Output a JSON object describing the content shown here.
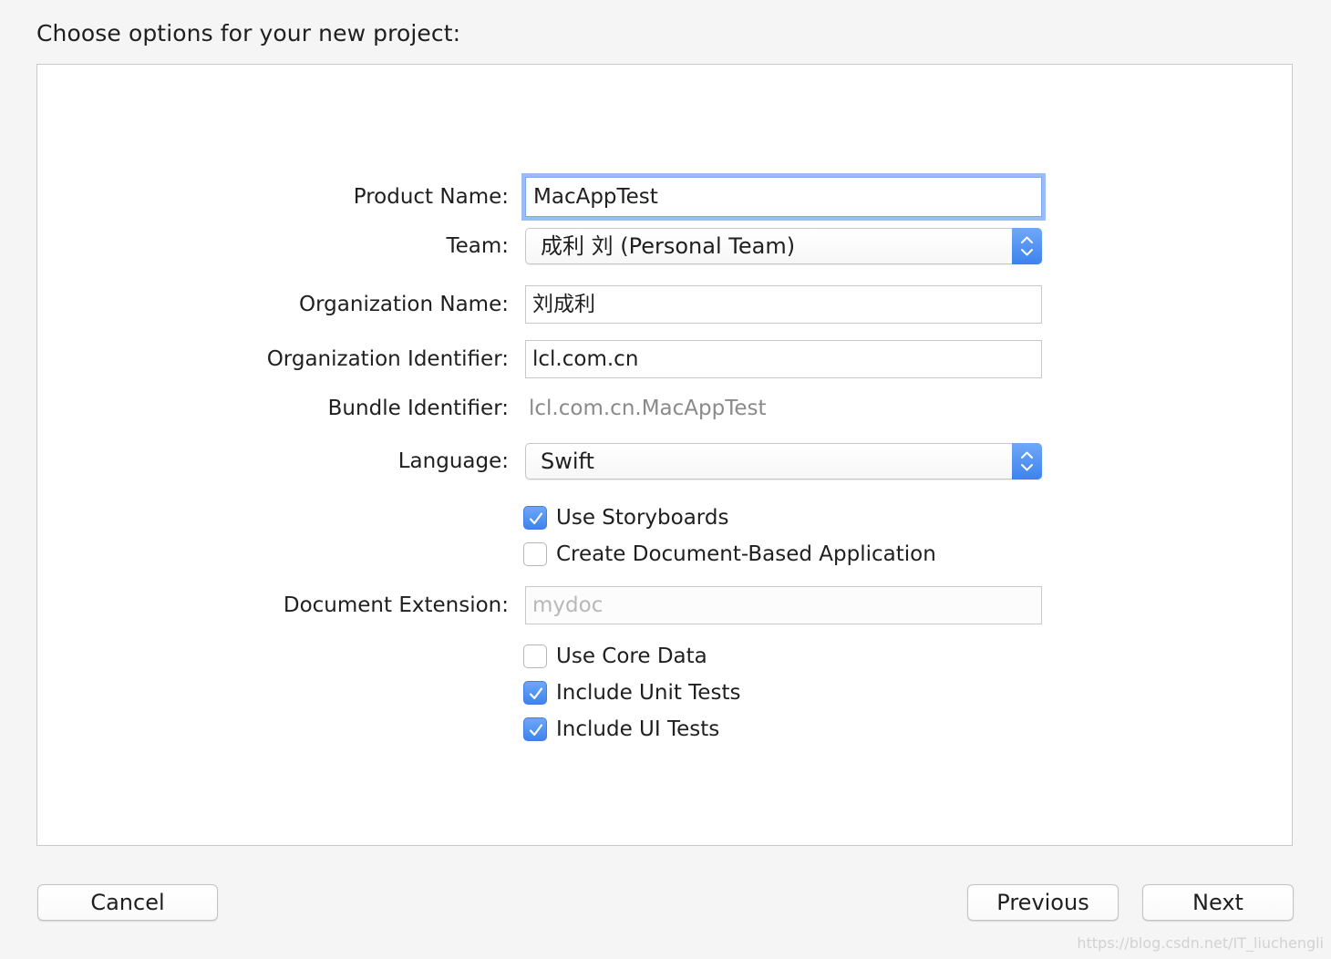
{
  "header": {
    "title": "Choose options for your new project:"
  },
  "form": {
    "product_name": {
      "label": "Product Name:",
      "value": "MacAppTest"
    },
    "team": {
      "label": "Team:",
      "value": "成利 刘 (Personal Team)"
    },
    "organization_name": {
      "label": "Organization Name:",
      "value": "刘成利"
    },
    "organization_identifier": {
      "label": "Organization Identifier:",
      "value": "lcl.com.cn"
    },
    "bundle_identifier": {
      "label": "Bundle Identifier:",
      "value": "lcl.com.cn.MacAppTest"
    },
    "language": {
      "label": "Language:",
      "value": "Swift"
    },
    "use_storyboards": {
      "label": "Use Storyboards",
      "checked": true
    },
    "create_document_based": {
      "label": "Create Document-Based Application",
      "checked": false
    },
    "document_extension": {
      "label": "Document Extension:",
      "placeholder": "mydoc"
    },
    "use_core_data": {
      "label": "Use Core Data",
      "checked": false
    },
    "include_unit_tests": {
      "label": "Include Unit Tests",
      "checked": true
    },
    "include_ui_tests": {
      "label": "Include UI Tests",
      "checked": true
    }
  },
  "footer": {
    "cancel_label": "Cancel",
    "previous_label": "Previous",
    "next_label": "Next",
    "watermark": "https://blog.csdn.net/IT_liuchengli"
  },
  "colors": {
    "accent": "#3f83ee",
    "focus_ring": "#9bbcf5",
    "window_background": "#f5f5f5"
  }
}
